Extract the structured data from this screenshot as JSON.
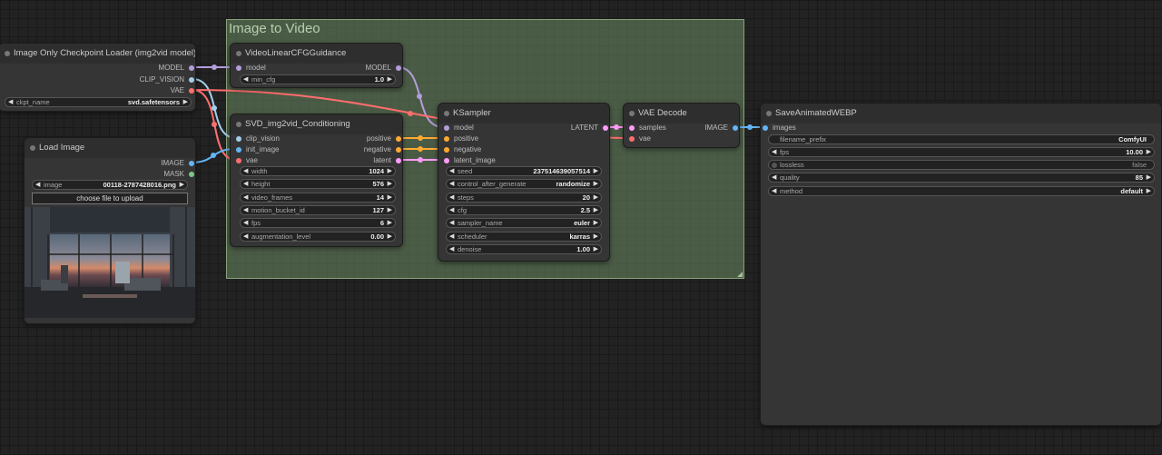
{
  "group": {
    "title": "Image to Video"
  },
  "colors": {
    "model": "#b39ddb",
    "clip_vision": "#a1cfe8",
    "vae": "#ff6e6e",
    "image": "#64b5f6",
    "conditioning": "#ffa931",
    "latent": "#ff9cf9",
    "mask": "#81c784"
  },
  "checkpoint": {
    "title": "Image Only Checkpoint Loader (img2vid model)",
    "outputs": {
      "model": "MODEL",
      "clip_vision": "CLIP_VISION",
      "vae": "VAE"
    },
    "ckpt_name": {
      "name": "ckpt_name",
      "value": "svd.safetensors"
    }
  },
  "load_image": {
    "title": "Load Image",
    "outputs": {
      "image": "IMAGE",
      "mask": "MASK"
    },
    "image": {
      "name": "image",
      "value": "00118-2787428016.png"
    },
    "upload_label": "choose file to upload"
  },
  "guidance": {
    "title": "VideoLinearCFGGuidance",
    "inputs": {
      "model": "model"
    },
    "outputs": {
      "model": "MODEL"
    },
    "min_cfg": {
      "name": "min_cfg",
      "value": "1.0"
    }
  },
  "conditioning": {
    "title": "SVD_img2vid_Conditioning",
    "inputs": {
      "clip_vision": "clip_vision",
      "init_image": "init_image",
      "vae": "vae"
    },
    "outputs": {
      "positive": "positive",
      "negative": "negative",
      "latent": "latent"
    },
    "widgets": [
      {
        "name": "width",
        "value": "1024"
      },
      {
        "name": "height",
        "value": "576"
      },
      {
        "name": "video_frames",
        "value": "14"
      },
      {
        "name": "motion_bucket_id",
        "value": "127"
      },
      {
        "name": "fps",
        "value": "6"
      },
      {
        "name": "augmentation_level",
        "value": "0.00"
      }
    ]
  },
  "ksampler": {
    "title": "KSampler",
    "inputs": {
      "model": "model",
      "positive": "positive",
      "negative": "negative",
      "latent_image": "latent_image"
    },
    "outputs": {
      "latent": "LATENT"
    },
    "widgets": [
      {
        "name": "seed",
        "value": "237514639057514"
      },
      {
        "name": "control_after_generate",
        "value": "randomize"
      },
      {
        "name": "steps",
        "value": "20"
      },
      {
        "name": "cfg",
        "value": "2.5"
      },
      {
        "name": "sampler_name",
        "value": "euler"
      },
      {
        "name": "scheduler",
        "value": "karras"
      },
      {
        "name": "denoise",
        "value": "1.00"
      }
    ]
  },
  "vae_decode": {
    "title": "VAE Decode",
    "inputs": {
      "samples": "samples",
      "vae": "vae"
    },
    "outputs": {
      "image": "IMAGE"
    }
  },
  "save_webp": {
    "title": "SaveAnimatedWEBP",
    "inputs": {
      "images": "images"
    },
    "filename_prefix": {
      "name": "filename_prefix",
      "value": "ComfyUI"
    },
    "fps": {
      "name": "fps",
      "value": "10.00"
    },
    "lossless": {
      "name": "lossless",
      "value": "false"
    },
    "quality": {
      "name": "quality",
      "value": "85"
    },
    "method": {
      "name": "method",
      "value": "default"
    }
  }
}
